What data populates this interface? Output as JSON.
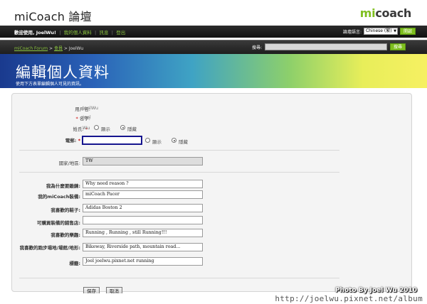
{
  "header": {
    "site_title": "miCoach 論壇",
    "logo_mi": "mi",
    "logo_coach": "coach",
    "accent_color": "#7fbf1f"
  },
  "welcome_bar": {
    "greeting": "歡迎使用, JoelWu!",
    "links": [
      "我的個人資料",
      "訊息",
      "登出"
    ],
    "language_label": "論壇語言:",
    "language_value": "Chinese (繁)",
    "go_label": "開啟"
  },
  "nav": {
    "crumbs": [
      "miCoach Forum",
      "會員",
      "JoelWu"
    ],
    "separator": ">",
    "search_label": "搜尋:",
    "search_button": "搜尋"
  },
  "banner": {
    "title": "編輯個人資料",
    "subtitle": "使用下方表單編輯個人可見的資訊。"
  },
  "form": {
    "username_label": "用戶名:",
    "username_value": "JoelWu",
    "name_label": "名字:",
    "name_value": "Joel",
    "surname_label": "姓氏:",
    "surname_value": "Wu",
    "surname_options": [
      "顯示",
      "隱藏"
    ],
    "email_label": "電郵:",
    "email_value": "",
    "email_options": [
      "顯示",
      "隱藏"
    ],
    "country_label": "國家/地區:",
    "country_value": "TW",
    "why_label": "我為什麼要鍛鍊:",
    "why_value": "Why need reason ?",
    "gear_label": "我的miCoach裝備:",
    "gear_value": "miCoach Pacer",
    "shoes_label": "我喜歡的鞋子:",
    "shoes_value": "Adidas Boston 2",
    "store_label": "可購買裝備的銷售店:",
    "store_value": "",
    "music_label": "我喜歡的樂趣:",
    "music_value": "Running , Running , still Running!!!",
    "route_label": "我喜歡的跑步場地/場館/地形:",
    "route_value": "Bikeway, Riverside path, mountain road...",
    "tags_label": "標籤:",
    "tags_value": "Joel joelwu.pixnet.net running"
  },
  "buttons": {
    "save": "保存",
    "cancel": "取消"
  },
  "watermark": {
    "credit": "Photo By Joel Wu 2010",
    "url": "http://joelwu.pixnet.net/album"
  }
}
